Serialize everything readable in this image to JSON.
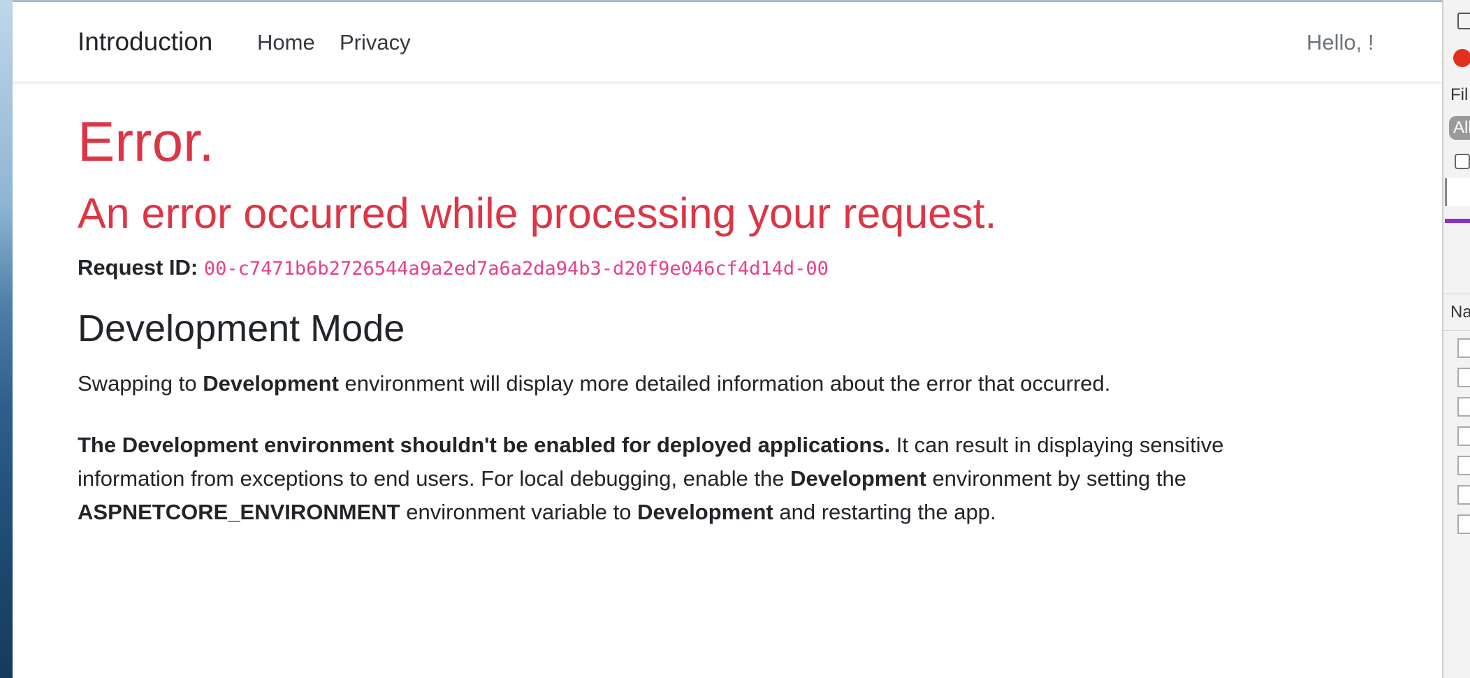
{
  "navbar": {
    "brand": "Introduction",
    "links": [
      "Home",
      "Privacy"
    ],
    "greeting": "Hello, !"
  },
  "error": {
    "title": "Error.",
    "subtitle": "An error occurred while processing your request.",
    "request_label": "Request ID:",
    "request_id": "00-c7471b6b2726544a9a2ed7a6a2da94b3-d20f9e046cf4d14d-00"
  },
  "dev_mode": {
    "heading": "Development Mode",
    "p1_before": "Swapping to ",
    "p1_bold": "Development",
    "p1_after": " environment will display more detailed information about the error that occurred.",
    "p2_bold_lead": "The Development environment shouldn't be enabled for deployed applications.",
    "p2_text1": " It can result in displaying sensitive information from exceptions to end users. For local debugging, enable the ",
    "p2_bold2": "Development",
    "p2_text2": " environment by setting the ",
    "p2_bold3": "ASPNETCORE_ENVIRONMENT",
    "p2_text3": " environment variable to ",
    "p2_bold4": "Development",
    "p2_text4": " and restarting the app."
  },
  "devtools": {
    "filter_label": "Fil",
    "all_pill": "All",
    "name_col": "Na"
  }
}
